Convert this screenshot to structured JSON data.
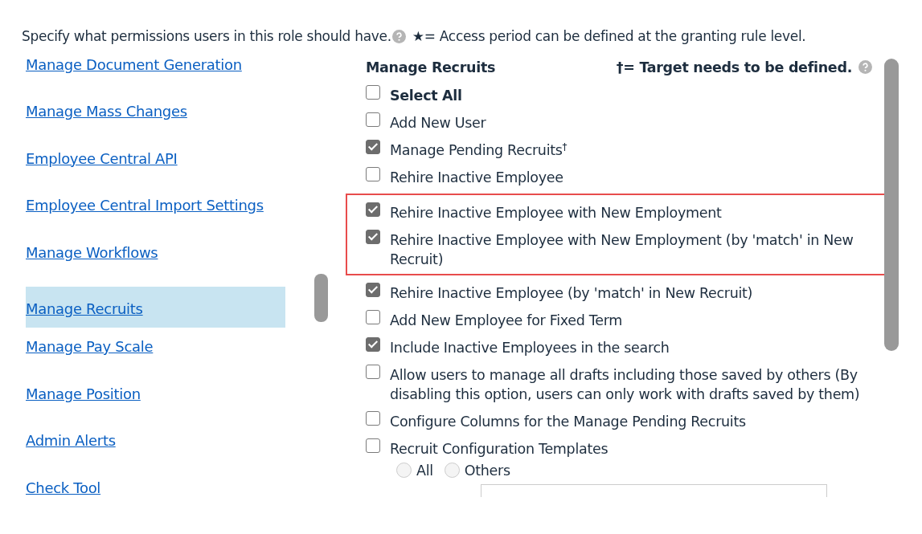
{
  "intro": {
    "text": "Specify what permissions users in this role should have.",
    "legend": "★= Access period can be defined at the granting rule level."
  },
  "categories": [
    {
      "label": "Manage Document Generation",
      "selected": false
    },
    {
      "label": "Manage Mass Changes",
      "selected": false
    },
    {
      "label": "Employee Central API",
      "selected": false
    },
    {
      "label": "Employee Central Import Settings",
      "selected": false
    },
    {
      "label": "Manage Workflows",
      "selected": false
    },
    {
      "label": "Manage Recruits",
      "selected": true
    },
    {
      "label": "Manage Pay Scale",
      "selected": false
    },
    {
      "label": "Manage Position",
      "selected": false
    },
    {
      "label": "Admin Alerts",
      "selected": false
    },
    {
      "label": "Check Tool",
      "selected": false
    }
  ],
  "panel": {
    "title": "Manage Recruits",
    "legend": "†= Target needs to be defined.",
    "items": [
      {
        "kind": "select_all",
        "label": "Select All",
        "checked": false
      },
      {
        "kind": "checkbox",
        "label": "Add New User",
        "checked": false
      },
      {
        "kind": "checkbox",
        "label": "Manage Pending Recruits$^{†}$",
        "checked": true
      },
      {
        "kind": "checkbox",
        "label": "Rehire Inactive Employee",
        "checked": false
      },
      {
        "kind": "highlight",
        "items": [
          {
            "kind": "checkbox",
            "label": "Rehire Inactive Employee with New Employment",
            "checked": true
          },
          {
            "kind": "checkbox",
            "label": "Rehire Inactive Employee with New Employment (by 'match' in New Recruit)",
            "checked": true
          }
        ]
      },
      {
        "kind": "checkbox",
        "label": "Rehire Inactive Employee (by 'match' in New Recruit)",
        "checked": true
      },
      {
        "kind": "checkbox",
        "label": "Add New Employee for Fixed Term",
        "checked": false
      },
      {
        "kind": "checkbox",
        "label": "Include Inactive Employees in the search",
        "checked": true
      },
      {
        "kind": "checkbox",
        "label": "Allow users to manage all drafts including those saved by others (By disabling this option, users can only work with drafts saved by them)",
        "checked": false
      },
      {
        "kind": "checkbox",
        "label": "Configure Columns for the Manage Pending Recruits",
        "checked": false
      },
      {
        "kind": "checkbox",
        "label": "Recruit Configuration Templates",
        "checked": false
      },
      {
        "kind": "radios",
        "options": [
          {
            "label": "All",
            "selected": false
          },
          {
            "label": "Others",
            "selected": false
          }
        ]
      },
      {
        "kind": "select"
      }
    ]
  }
}
